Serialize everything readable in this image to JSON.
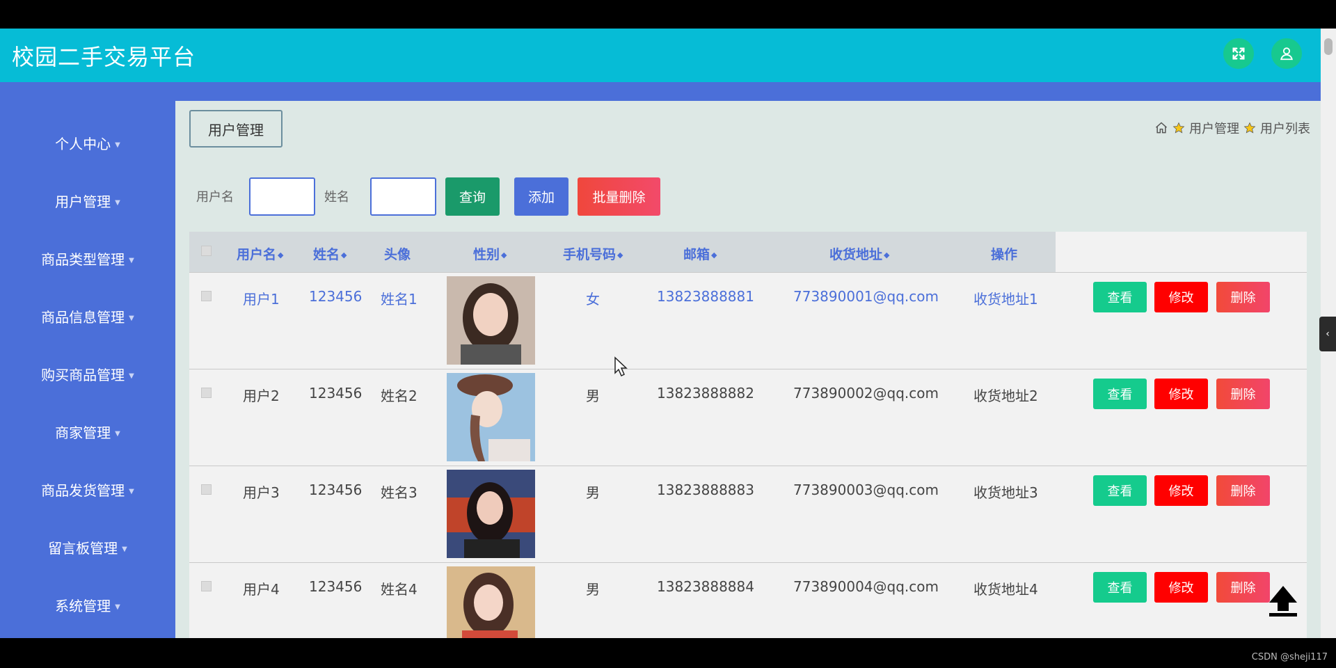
{
  "header": {
    "app_title": "校园二手交易平台",
    "fullscreen_icon": "expand-icon",
    "user_icon": "user-icon",
    "color": "#06bcd6"
  },
  "sidebar": {
    "items": [
      {
        "label": "个人中心"
      },
      {
        "label": "用户管理"
      },
      {
        "label": "商品类型管理"
      },
      {
        "label": "商品信息管理"
      },
      {
        "label": "购买商品管理"
      },
      {
        "label": "商家管理"
      },
      {
        "label": "商品发货管理"
      },
      {
        "label": "留言板管理"
      },
      {
        "label": "系统管理"
      }
    ],
    "color": "#4b6fd9"
  },
  "main": {
    "tab_label": "用户管理",
    "breadcrumb": [
      "用户管理",
      "用户列表"
    ],
    "search": {
      "username_label": "用户名",
      "name_label": "姓名",
      "username_value": "",
      "name_value": ""
    },
    "buttons": {
      "query": "查询",
      "add": "添加",
      "batch_delete": "批量删除"
    },
    "table": {
      "columns": [
        "用户名",
        "姓名",
        "头像",
        "性别",
        "手机号码",
        "邮箱",
        "收货地址",
        "操作"
      ],
      "rows": [
        {
          "username": "用户1",
          "password": "123456",
          "name": "姓名1",
          "gender": "女",
          "phone": "13823888881",
          "email": "773890001@qq.com",
          "address": "收货地址1"
        },
        {
          "username": "用户2",
          "password": "123456",
          "name": "姓名2",
          "gender": "男",
          "phone": "13823888882",
          "email": "773890002@qq.com",
          "address": "收货地址2"
        },
        {
          "username": "用户3",
          "password": "123456",
          "name": "姓名3",
          "gender": "男",
          "phone": "13823888883",
          "email": "773890003@qq.com",
          "address": "收货地址3"
        },
        {
          "username": "用户4",
          "password": "123456",
          "name": "姓名4",
          "gender": "男",
          "phone": "13823888884",
          "email": "773890004@qq.com",
          "address": "收货地址4"
        }
      ],
      "actions": {
        "view": "查看",
        "edit": "修改",
        "delete": "删除"
      }
    }
  },
  "watermark": "CSDN @sheji117",
  "colors": {
    "query": "#1a9a6a",
    "add": "#4b6fd9",
    "batch_delete": "#f0473c",
    "view": "#15cb8d",
    "edit": "#ff0000",
    "delete": "#f24a4a"
  }
}
